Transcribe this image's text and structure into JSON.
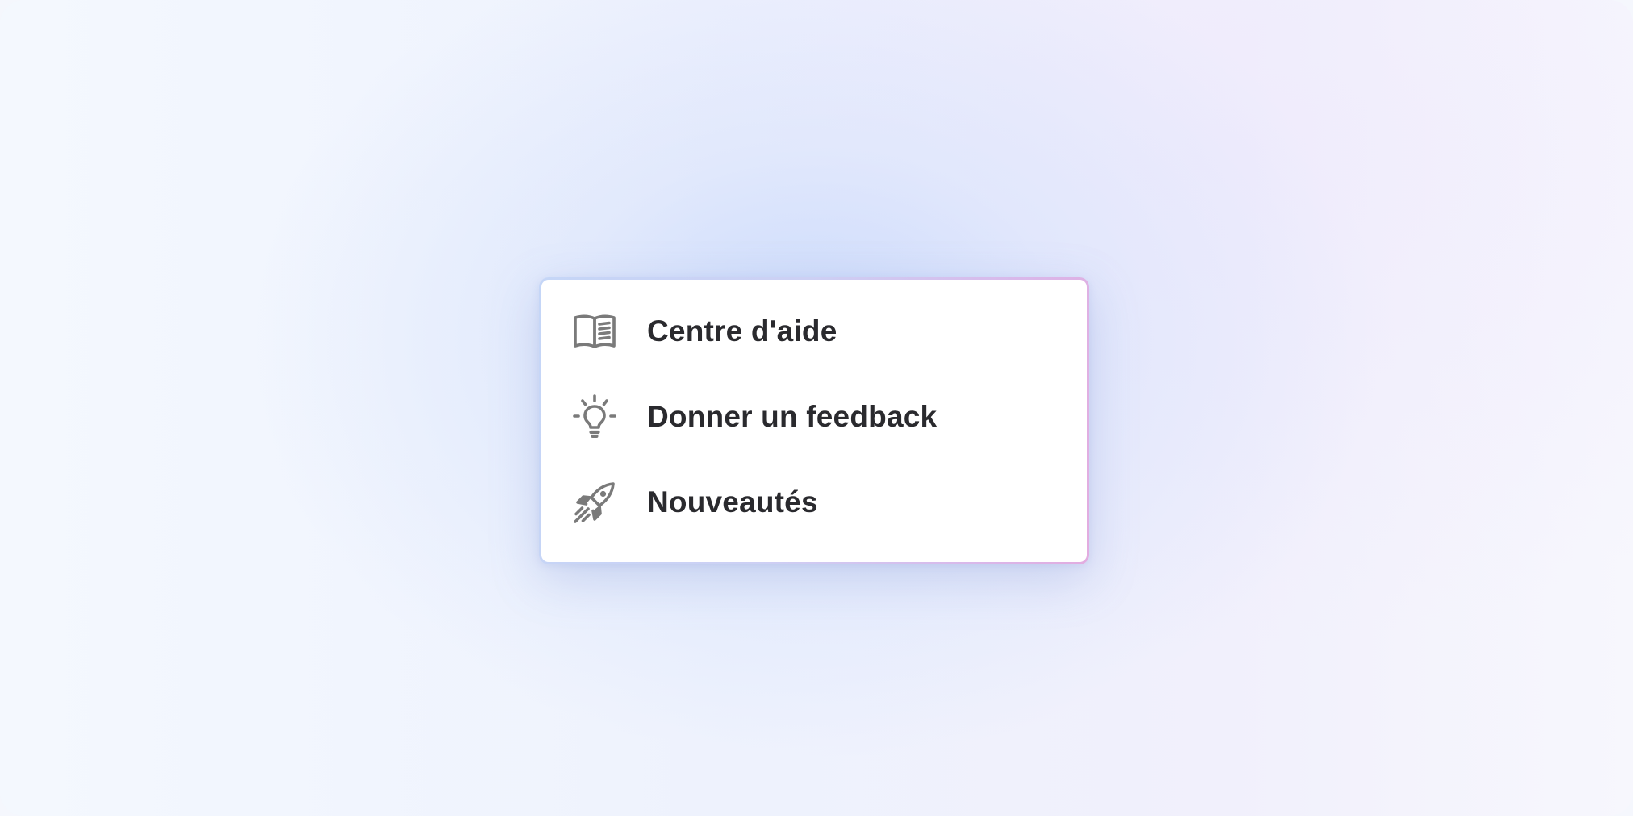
{
  "menu": {
    "items": [
      {
        "label": "Centre d'aide",
        "icon": "book-icon"
      },
      {
        "label": "Donner un feedback",
        "icon": "lightbulb-icon"
      },
      {
        "label": "Nouveautés",
        "icon": "rocket-icon"
      }
    ]
  },
  "colors": {
    "icon": "#7a7a7a",
    "label": "#2a2a2e",
    "border_start": "#c5d6f7",
    "border_end": "#e2ace0"
  }
}
